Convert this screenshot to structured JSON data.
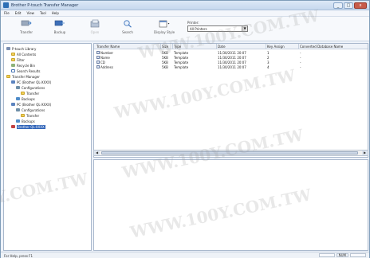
{
  "window": {
    "title": "Brother P-touch Transfer Manager",
    "controls": {
      "minimize": "_",
      "maximize": "□",
      "close": "x"
    }
  },
  "menu": [
    "File",
    "Edit",
    "View",
    "Tool",
    "Help"
  ],
  "toolbar": {
    "buttons": [
      {
        "label": "Transfer",
        "icon": "transfer-icon"
      },
      {
        "label": "Backup",
        "icon": "backup-icon"
      },
      {
        "label": "Open",
        "icon": "open-icon"
      },
      {
        "label": "Search",
        "icon": "search-icon"
      },
      {
        "label": "Display Style",
        "icon": "display-style-icon"
      }
    ],
    "printer_label": "Printer:",
    "printer_value": "All Printers"
  },
  "tree": [
    {
      "label": "P-touch Library",
      "icon": "lib",
      "indent": 0
    },
    {
      "label": "All Contents",
      "icon": "folder",
      "indent": 1
    },
    {
      "label": "Filter",
      "icon": "folder",
      "indent": 1
    },
    {
      "label": "Recycle Bin",
      "icon": "recycle",
      "indent": 1
    },
    {
      "label": "Search Results",
      "icon": "search",
      "indent": 1
    },
    {
      "label": "Transfer Manager",
      "icon": "folder",
      "indent": 0
    },
    {
      "label": "PC (Brother QL-XXXX)",
      "icon": "pc",
      "indent": 1
    },
    {
      "label": "Configurations",
      "icon": "config",
      "indent": 2
    },
    {
      "label": "Transfer",
      "icon": "folder",
      "indent": 3
    },
    {
      "label": "Backups",
      "icon": "backup",
      "indent": 2
    },
    {
      "label": "PC (Brother QL-XXXX)",
      "icon": "pc",
      "indent": 1
    },
    {
      "label": "Configurations",
      "icon": "config",
      "indent": 2
    },
    {
      "label": "Transfer",
      "icon": "folder",
      "indent": 3
    },
    {
      "label": "Backups",
      "icon": "backup",
      "indent": 2
    },
    {
      "label": "Brother QL-XXXX",
      "icon": "device",
      "indent": 1,
      "selected": true
    }
  ],
  "list": {
    "columns": [
      "Transfer Name",
      "Size",
      "Type",
      "Date",
      "Key Assign",
      "Converted Database Name"
    ],
    "rows": [
      [
        "Number",
        "5KB",
        "Template",
        "11/30/2011 20:07",
        "1",
        "-"
      ],
      [
        "Name",
        "5KB",
        "Template",
        "11/30/2011 20:07",
        "2",
        "-"
      ],
      [
        "CD",
        "5KB",
        "Template",
        "11/30/2011 20:07",
        "3",
        "-"
      ],
      [
        "Address",
        "5KB",
        "Template",
        "11/30/2011 20:07",
        "4",
        "-"
      ]
    ]
  },
  "status": {
    "text": "For Help, press F1",
    "num": "NUM"
  },
  "watermark": "WWW.100Y.COM.TW"
}
